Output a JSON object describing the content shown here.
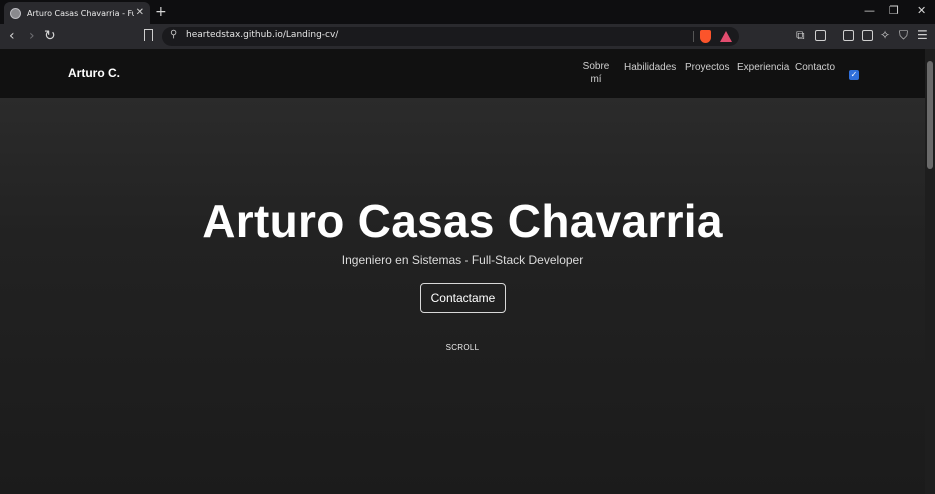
{
  "browser": {
    "tab": {
      "title": "Arturo Casas Chavarria - Full-Stac",
      "close_icon": "close-icon"
    },
    "new_tab_label": "+",
    "window_controls": {
      "minimize": "—",
      "restore": "❐",
      "close": "✕"
    },
    "nav": {
      "back": "‹",
      "forward": "›",
      "reload": "↻"
    },
    "address_bar": {
      "url": "heartedstax.github.io/Landing-cv/"
    },
    "colors": {
      "chrome_bg": "#2a2a2e",
      "tab_strip_bg": "#0e0e10",
      "brave_orange": "#fb542b"
    }
  },
  "site": {
    "brand": "Arturo C.",
    "nav_links": [
      "Sobre mí",
      "Habilidades",
      "Proyectos",
      "Experiencia",
      "Contacto"
    ],
    "theme_toggle_checked": true,
    "hero": {
      "title": "Arturo Casas Chavarria",
      "subtitle": "Ingeniero en Sistemas - Full-Stack Developer",
      "cta_label": "Contactame",
      "scroll_hint": "SCROLL"
    },
    "colors": {
      "nav_bg": "#111111",
      "hero_bg": "#222222",
      "accent": "#2f6fdb"
    }
  }
}
